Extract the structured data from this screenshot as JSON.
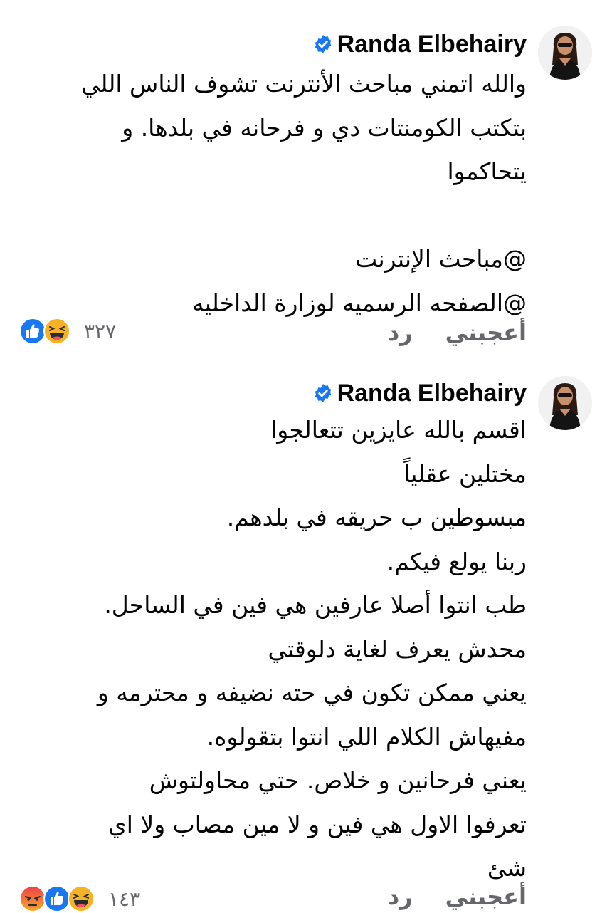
{
  "comments": [
    {
      "author": "Randa Elbehairy",
      "lines": [
        "والله اتمني مباحث الأنترنت تشوف الناس اللي",
        "بتكتب الكومنتات دي و فرحانه في بلدها. و",
        "يتحاكموا",
        "",
        "@مباحث الإنترنت",
        "@الصفحه الرسميه لوزارة الداخليه"
      ],
      "like_label": "أعجبني",
      "reply_label": "رد",
      "reaction_count": "٣٢٧",
      "reactions": [
        "like-icon",
        "haha-icon"
      ]
    },
    {
      "author": "Randa Elbehairy",
      "lines": [
        "اقسم بالله عايزين تتعالجوا",
        "مختلين عقلياً",
        "مبسوطين ب حريقه في بلدهم.",
        "ربنا يولع فيكم.",
        "طب انتوا أصلا عارفين هي فين في الساحل.",
        "محدش يعرف لغاية دلوقتي",
        "يعني ممكن تكون في حته نضيفه و محترمه و",
        "مفيهاش الكلام اللي انتوا بتقولوه.",
        "يعني فرحانين و خلاص. حتي محاولتوش",
        "تعرفوا الاول هي فين و لا مين مصاب ولا اي",
        "شئ"
      ],
      "like_label": "أعجبني",
      "reply_label": "رد",
      "reaction_count": "١٤٣",
      "reactions": [
        "angry-icon",
        "like-icon",
        "haha-icon"
      ]
    }
  ],
  "colors": {
    "verified_blue": "#1877F2",
    "like_blue": "#1877F2",
    "haha_yellow": "#F7B125",
    "angry_orange": "#E9710F",
    "secondary_text": "#65676B"
  }
}
